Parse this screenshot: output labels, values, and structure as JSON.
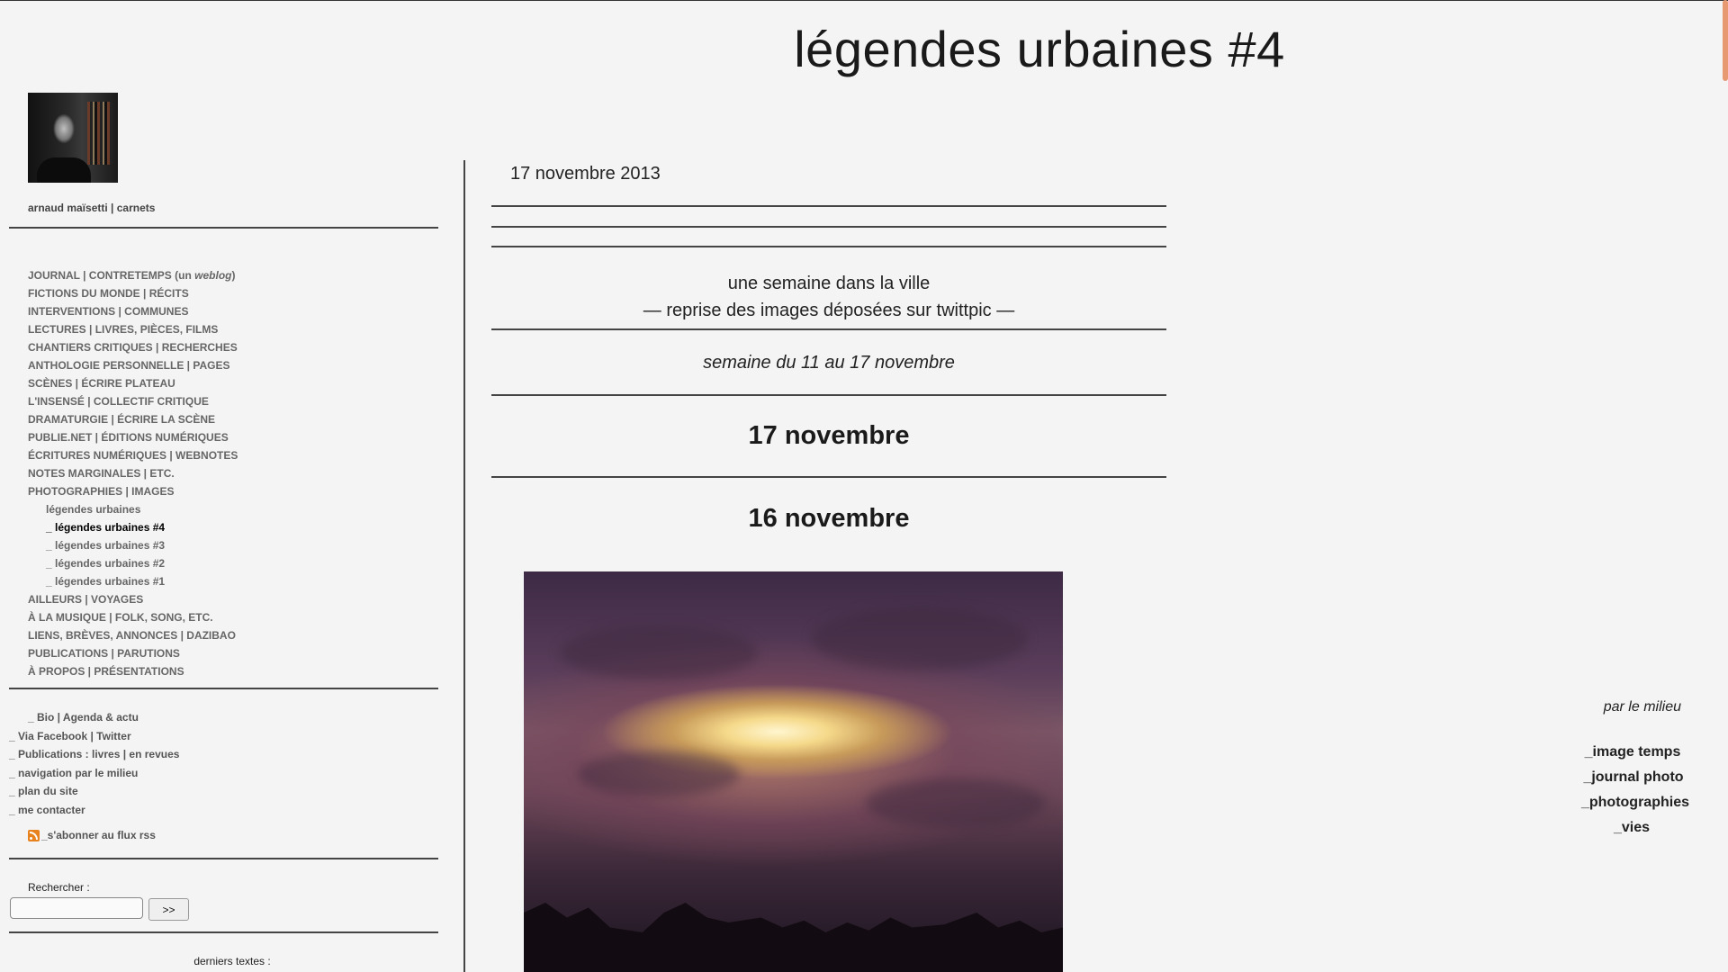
{
  "site_title": "légendes urbaines #4",
  "sidebar": {
    "author": "arnaud maïsetti | carnets",
    "menu": [
      "JOURNAL | CONTRETEMPS (un weblog)",
      "FICTIONS DU MONDE | RÉCITS",
      "INTERVENTIONS | COMMUNES",
      "LECTURES | LIVRES, PIÈCES, FILMS",
      "CHANTIERS CRITIQUES | RECHERCHES",
      "ANTHOLOGIE PERSONNELLE | PAGES",
      "SCÈNES | ÉCRIRE PLATEAU",
      "L'INSENSÉ | COLLECTIF CRITIQUE",
      "DRAMATURGIE | ÉCRIRE LA SCÈNE",
      "PUBLIE.NET | ÉDITIONS NUMÉRIQUES",
      "ÉCRITURES NUMÉRIQUES | WEBNOTES",
      "NOTES MARGINALES | ETC.",
      "PHOTOGRAPHIES | IMAGES",
      "légendes urbaines",
      "_ légendes urbaines #4",
      "_ légendes urbaines #3",
      "_ légendes urbaines #2",
      "_ légendes urbaines #1",
      "AILLEURS | VOYAGES",
      "À LA MUSIQUE | FOLK, SONG, ETC.",
      "LIENS, BRÈVES, ANNONCES | DAZIBAO",
      "PUBLICATIONS | PARUTIONS",
      "À PROPOS | PRÉSENTATIONS"
    ],
    "links": [
      "_ Bio | Agenda & actu",
      "_ Via Facebook | Twitter",
      "_ Publications : livres | en revues",
      "_ navigation par le milieu",
      "_ plan du site",
      "_ me contacter"
    ],
    "rss_label": "_s'abonner au flux rss",
    "search_label": "Rechercher :",
    "search_value": "",
    "search_button": ">>",
    "recent_label": "derniers textes :"
  },
  "main": {
    "date": "17 novembre 2013",
    "intro_line1": "une semaine dans la ville",
    "intro_line2": "— reprise des images déposées sur twittpic —",
    "week": "semaine du 11 au 17 novembre",
    "day1": "17 novembre",
    "day2": "16 novembre"
  },
  "right": {
    "par_le_milieu": "par le milieu",
    "links": [
      "_image temps",
      "_journal photo",
      "_photographies",
      "_vies"
    ]
  },
  "colors": {
    "background": "#f4f4f4",
    "scroll_thumb": "#e79a72",
    "rss": "#e8821f"
  }
}
